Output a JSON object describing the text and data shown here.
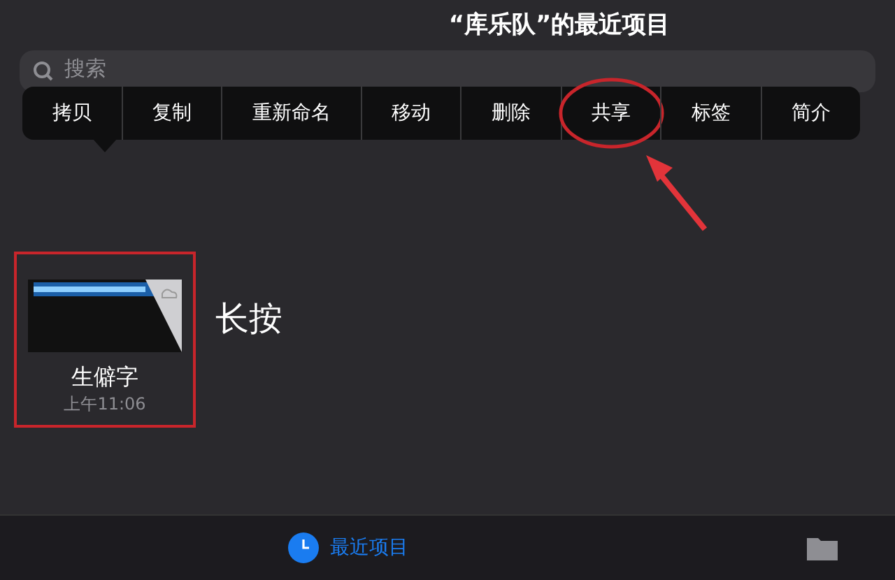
{
  "header": {
    "title": "“库乐队”的最近项目"
  },
  "search": {
    "placeholder": "搜索"
  },
  "context_menu": [
    {
      "label": "拷贝",
      "circled": false
    },
    {
      "label": "复制",
      "circled": false
    },
    {
      "label": "重新命名",
      "circled": false
    },
    {
      "label": "移动",
      "circled": false
    },
    {
      "label": "删除",
      "circled": false
    },
    {
      "label": "共享",
      "circled": true
    },
    {
      "label": "标签",
      "circled": false
    },
    {
      "label": "简介",
      "circled": false
    }
  ],
  "file": {
    "name": "生僻字",
    "time": "上午11:06",
    "highlighted": true
  },
  "annotation": {
    "text": "长按"
  },
  "tab_bar": [
    {
      "label": "最近项目",
      "selected": true,
      "kind": "clock"
    },
    {
      "kind": "folder",
      "selected": false
    }
  ]
}
